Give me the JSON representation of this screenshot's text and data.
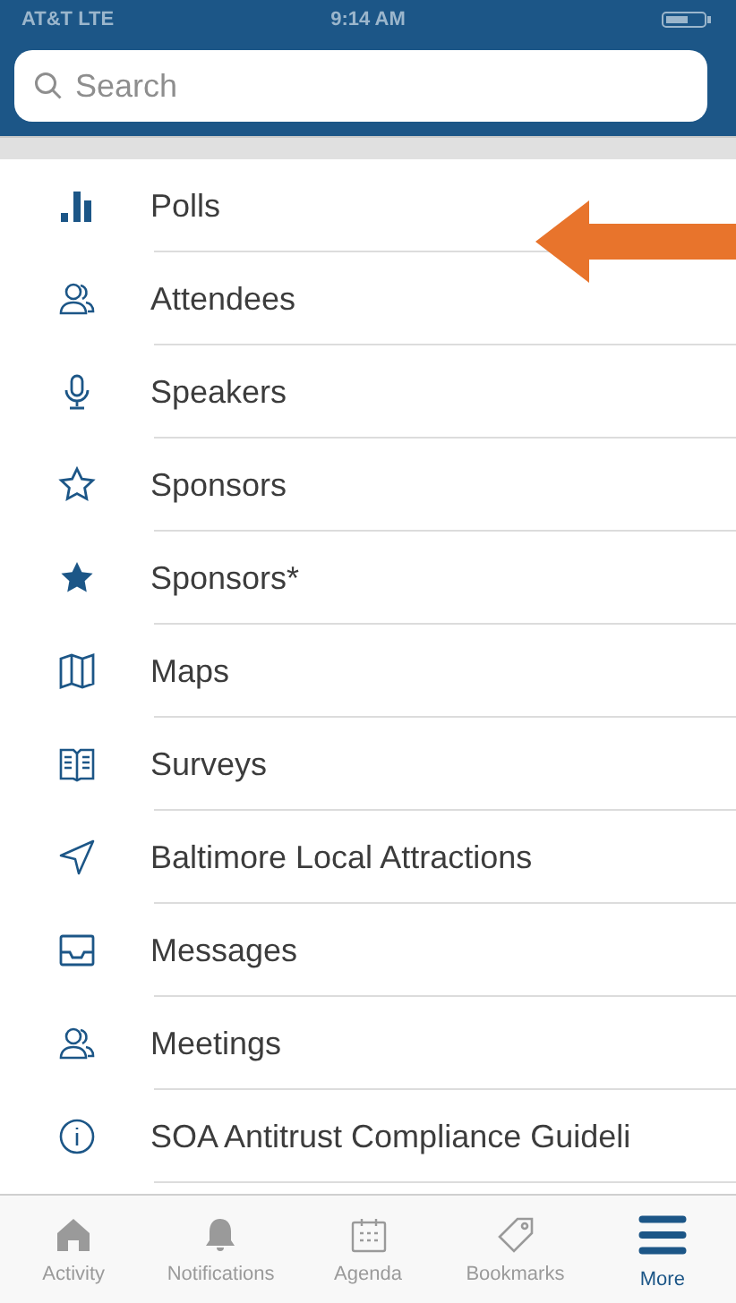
{
  "status_bar": {
    "carrier": "AT&T LTE",
    "time": "9:14 AM"
  },
  "search": {
    "placeholder": "Search"
  },
  "menu_items": [
    {
      "label": "Polls",
      "kind": "bars"
    },
    {
      "label": "Attendees",
      "kind": "people"
    },
    {
      "label": "Speakers",
      "kind": "mic"
    },
    {
      "label": "Sponsors",
      "kind": "star-outline"
    },
    {
      "label": "Sponsors*",
      "kind": "star-filled"
    },
    {
      "label": "Maps",
      "kind": "map"
    },
    {
      "label": "Surveys",
      "kind": "book"
    },
    {
      "label": "Baltimore Local Attractions",
      "kind": "pointer"
    },
    {
      "label": "Messages",
      "kind": "tray"
    },
    {
      "label": "Meetings",
      "kind": "people"
    },
    {
      "label": "SOA Antitrust Compliance Guideli",
      "kind": "info"
    }
  ],
  "annotation": {
    "kind": "arrow"
  },
  "tabs": [
    {
      "label": "Activity",
      "kind": "home",
      "selected": false
    },
    {
      "label": "Notifications",
      "kind": "bell",
      "selected": false
    },
    {
      "label": "Agenda",
      "kind": "calendar",
      "selected": false
    },
    {
      "label": "Bookmarks",
      "kind": "tag",
      "selected": false
    },
    {
      "label": "More",
      "kind": "menu",
      "selected": true
    }
  ]
}
